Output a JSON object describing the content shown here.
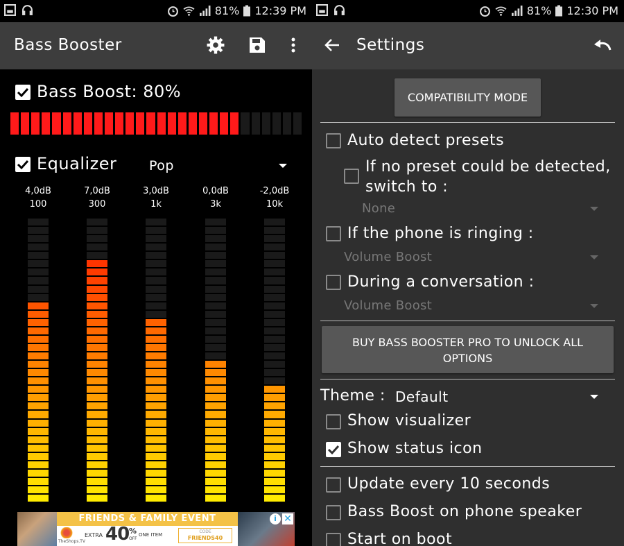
{
  "left": {
    "status": {
      "battery": "81%",
      "time": "12:39 PM"
    },
    "app_title": "Bass Booster",
    "bass": {
      "label": "Bass Boost: 80%",
      "checked": true,
      "level_fraction": 0.8,
      "segments": 28,
      "on_color": "#ff1a1a",
      "off_color": "#1a1a1a"
    },
    "equalizer": {
      "label": "Equalizer",
      "checked": true,
      "preset": "Pop",
      "bands": [
        {
          "gain": "4,0dB",
          "freq": "100",
          "level_fraction": 0.7
        },
        {
          "gain": "7,0dB",
          "freq": "300",
          "level_fraction": 0.85
        },
        {
          "gain": "3,0dB",
          "freq": "1k",
          "level_fraction": 0.65
        },
        {
          "gain": "0,0dB",
          "freq": "3k",
          "level_fraction": 0.5
        },
        {
          "gain": "-2,0dB",
          "freq": "10k",
          "level_fraction": 0.4
        }
      ],
      "segments_per_band": 34
    },
    "ad": {
      "banner": "FRIENDS & FAMILY EVENT",
      "store": "TheShops.TV",
      "extra": "EXTRA",
      "percent": "40",
      "percent_sign": "%",
      "off": "OFF",
      "one_item": "ONE ITEM",
      "code_label": "CODE",
      "code": "FRIENDS40",
      "info_icon": "info-icon",
      "close_icon": "close-icon"
    }
  },
  "right": {
    "status": {
      "battery": "81%",
      "time": "12:30 PM"
    },
    "title": "Settings",
    "compat_button": "COMPATIBILITY MODE",
    "auto_detect": {
      "label": "Auto detect presets",
      "checked": false
    },
    "no_preset": {
      "label_line1": "If no preset could be detected,",
      "label_line2": "switch to :",
      "checked": false,
      "value": "None"
    },
    "phone_ringing": {
      "label": "If the phone is ringing :",
      "checked": false,
      "value": "Volume Boost"
    },
    "conversation": {
      "label": "During a conversation :",
      "checked": false,
      "value": "Volume Boost"
    },
    "buy_button_line1": "BUY BASS BOOSTER PRO TO UNLOCK ALL",
    "buy_button_line2": "OPTIONS",
    "theme": {
      "label": "Theme :",
      "value": "Default"
    },
    "show_visualizer": {
      "label": "Show visualizer",
      "checked": false
    },
    "show_status_icon": {
      "label": "Show status icon",
      "checked": true
    },
    "update_every": {
      "label": "Update every 10 seconds",
      "checked": false
    },
    "bass_speaker": {
      "label": "Bass Boost on phone speaker",
      "checked": false
    },
    "start_boot": {
      "label": "Start on boot",
      "checked": false
    }
  }
}
